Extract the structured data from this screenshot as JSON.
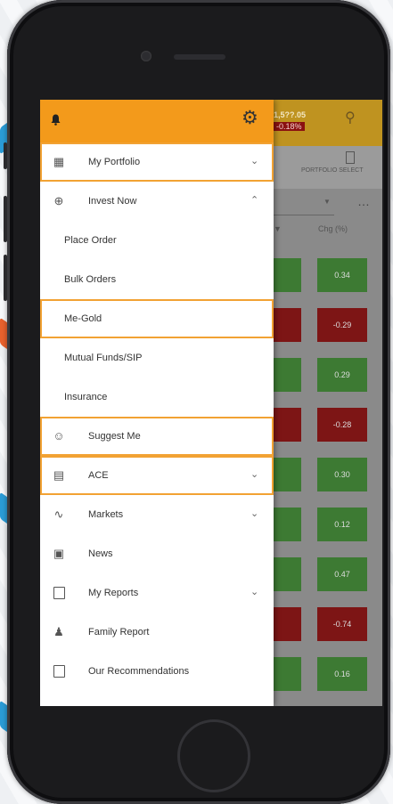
{
  "app": {
    "header": {
      "bell_icon": "bell-icon",
      "settings_icon": "gear-icon",
      "accent": "#f39a1b"
    },
    "menu": [
      {
        "id": "my-portfolio",
        "label": "My Portfolio",
        "icon": "briefcase-icon",
        "chevron": "down",
        "highlighted": true
      },
      {
        "id": "invest-now",
        "label": "Invest Now",
        "icon": "coins-icon",
        "chevron": "up",
        "highlighted": false
      },
      {
        "id": "place-order",
        "label": "Place Order",
        "sub": true
      },
      {
        "id": "bulk-orders",
        "label": "Bulk Orders",
        "sub": true
      },
      {
        "id": "me-gold",
        "label": "Me-Gold",
        "sub": true,
        "highlighted": true
      },
      {
        "id": "mutual-funds-sip",
        "label": "Mutual Funds/SIP",
        "sub": true
      },
      {
        "id": "insurance",
        "label": "Insurance",
        "sub": true
      },
      {
        "id": "suggest-me",
        "label": "Suggest Me",
        "icon": "people-chart-icon",
        "highlighted": true
      },
      {
        "id": "ace",
        "label": "ACE",
        "icon": "chart-board-icon",
        "chevron": "down",
        "highlighted": true
      },
      {
        "id": "markets",
        "label": "Markets",
        "icon": "line-chart-icon",
        "chevron": "down"
      },
      {
        "id": "news",
        "label": "News",
        "icon": "newspaper-icon"
      },
      {
        "id": "my-reports",
        "label": "My Reports",
        "icon": "report-icon",
        "chevron": "down"
      },
      {
        "id": "family-report",
        "label": "Family Report",
        "icon": "family-icon"
      },
      {
        "id": "our-recommendations",
        "label": "Our Recommendations",
        "icon": "bookmark-icon"
      }
    ],
    "background": {
      "index_value": "1,5??.05",
      "index_change": "-0.18%",
      "search_icon": "search-icon",
      "portfolio_label": "PORTFOLIO SELECT",
      "col_header_ltp": "▼",
      "col_header_chg": "Chg (%)",
      "more_label": "…",
      "changes": [
        {
          "value": "0.34",
          "dir": "up"
        },
        {
          "value": "-0.29",
          "dir": "down"
        },
        {
          "value": "0.29",
          "dir": "up"
        },
        {
          "value": "-0.28",
          "dir": "down"
        },
        {
          "value": "0.30",
          "dir": "up"
        },
        {
          "value": "0.12",
          "dir": "up"
        },
        {
          "value": "0.47",
          "dir": "up"
        },
        {
          "value": "-0.74",
          "dir": "down"
        },
        {
          "value": "0.16",
          "dir": "up"
        }
      ]
    }
  }
}
